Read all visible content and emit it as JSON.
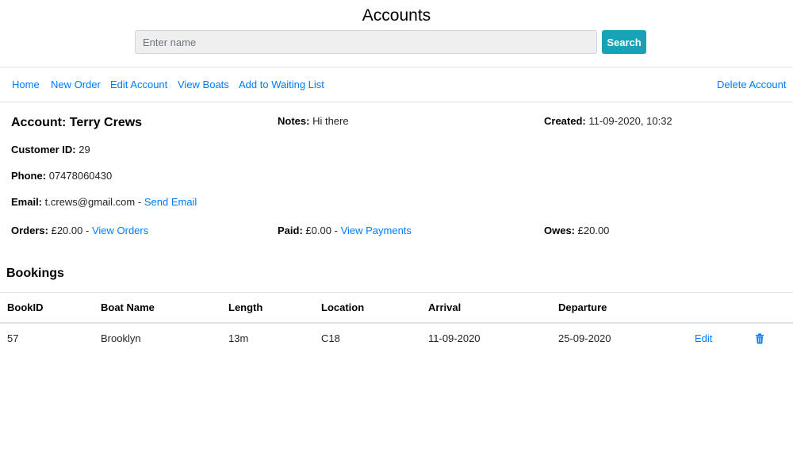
{
  "header": {
    "title": "Accounts",
    "search_placeholder": "Enter name",
    "search_value": "",
    "search_button": "Search"
  },
  "nav": {
    "home": "Home",
    "new_order": "New Order",
    "edit_account": "Edit Account",
    "view_boats": "View Boats",
    "add_waiting": "Add to Waiting List",
    "delete_account": "Delete Account"
  },
  "account": {
    "title": "Account: Terry Crews",
    "notes_label": "Notes:",
    "notes_value": "Hi there",
    "created_label": "Created:",
    "created_value": "11-09-2020, 10:32",
    "customer_id_label": "Customer ID:",
    "customer_id_value": "29",
    "phone_label": "Phone:",
    "phone_value": "07478060430",
    "email_label": "Email:",
    "email_value": "t.crews@gmail.com",
    "email_sep": "-",
    "send_email": "Send Email",
    "orders_label": "Orders:",
    "orders_value": "£20.00",
    "orders_sep": "-",
    "view_orders": "View Orders",
    "paid_label": "Paid:",
    "paid_value": "£0.00",
    "paid_sep": "-",
    "view_payments": "View Payments",
    "owes_label": "Owes:",
    "owes_value": "£20.00"
  },
  "bookings": {
    "title": "Bookings",
    "columns": [
      "BookID",
      "Boat Name",
      "Length",
      "Location",
      "Arrival",
      "Departure"
    ],
    "rows": [
      {
        "book_id": "57",
        "boat_name": "Brooklyn",
        "length": "13m",
        "location": "C18",
        "arrival": "11-09-2020",
        "departure": "25-09-2020",
        "edit": "Edit",
        "delete_icon": "trash-icon"
      }
    ]
  },
  "colors": {
    "link": "#007bff",
    "search_button": "#17a2b8",
    "border": "#dee2e6"
  }
}
